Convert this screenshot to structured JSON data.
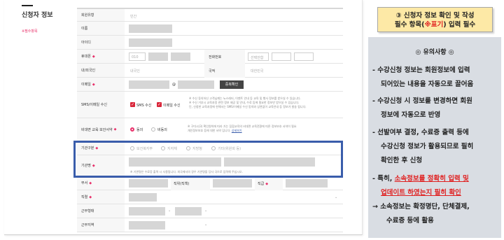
{
  "section": {
    "title": "신청자 정보",
    "required_note": "※필수항목"
  },
  "form": {
    "member_type": {
      "label": "회원유형",
      "value": "민간"
    },
    "name": {
      "label": "이름"
    },
    "user_id": {
      "label": "아이디"
    },
    "mobile": {
      "label": "휴대폰",
      "prefix": "010"
    },
    "phone": {
      "label": "전화번호",
      "prefix": "선택안함"
    },
    "nationality": {
      "label": "내/외국인",
      "value": "내국인"
    },
    "country": {
      "label": "국적",
      "value": "대한민국"
    },
    "email": {
      "label": "이메일",
      "at": "@",
      "verify_button": "중복확인"
    },
    "sms_email": {
      "label": "SMS/이메일 수신",
      "sms": "SMS 수신",
      "email": "이메일 수신",
      "info1": "※ 수신 동의하신 고객님께는 뉴스레터, 이벤트 안내 등 교육 및 행사 정보를 받으실 수 있습니다.",
      "info2": "※ 수신 거부시 교육과정 관련 정보 제공 및 안내, 수료 등에 필요한 정보만 받으실 수 있습니다.",
      "info3": "단, 신청한 교육과정에 한해서는 SMS/이메일 수신 동의와 상관없이 교육안내 등 정보가 발송 됩니다."
    },
    "non_face": {
      "label": "비대면 교육 보안서약",
      "agree": "동의",
      "disagree": "비동의",
      "info1": "※ 구미시(3) 확인원칙에 따라 가는 집합교육의 비대면 교육전환에 따른 정보보호 서약이 필요",
      "info2": "개인정보보호 등에 대한 서약 입니다. ",
      "detail_link": "상세보기"
    },
    "org_type": {
      "label": "기관구분",
      "options": [
        "보건복지부",
        "지자체",
        "지방청",
        "기타(위원회 등)"
      ]
    },
    "org_name": {
      "label": "기관명",
      "info": "※ 기관명은 수료증 출력 시 사용됩니다. 외국에서의 경우 기관명을 당사 국으로 입력해 주십시오."
    },
    "dept": {
      "label": "부서"
    },
    "position": {
      "label": "직위(직책)"
    },
    "grade": {
      "label": "직급"
    },
    "job_type": {
      "label": "직렬"
    },
    "work_type": {
      "label": "근무형태"
    },
    "work_region": {
      "label": "근무지역"
    }
  },
  "callout": {
    "line1": "③ 신청자 정보 확인 및 작성",
    "line2_pre": "필수 항목(",
    "line2_red": "※표기",
    "line2_post": ") 입력 필수"
  },
  "notes": {
    "title": "◎ 유의사항 ◎",
    "n1a": "- 수강신청 정보는 회원정보에 입력",
    "n1b": "되어있는 내용을 자동으로 끌어옴",
    "n2a": "- 수강신청 시 정보를 변경하면 회원",
    "n2b": "정보에 자동으로 반영",
    "n3a": "- 선발여부 결정, 수료증 출력 등에",
    "n3b": "수강신청 정보가 활용되므로 필히",
    "n3c": "확인한 후 신청",
    "n4_pre": "- 특히, ",
    "n4_hl": "소속정보를 정확히 입력 및",
    "n4b": "업데이트 하였는지 필히 확인",
    "n5a": "→ 소속정보는 확정명단, 단체결제,",
    "n5b": "수료증 등에 활용"
  },
  "colors": {
    "required": "#e8306a",
    "highlight_box": "#3a5dab",
    "callout_bg": "#fde9a6",
    "notes_bg": "#d9dde3",
    "red_text": "#e02020"
  }
}
